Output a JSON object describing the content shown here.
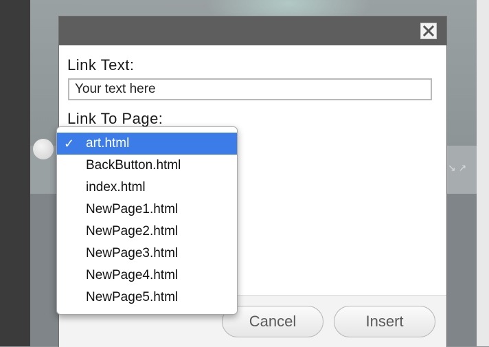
{
  "dialog": {
    "close_glyph": "×",
    "link_text_label": "Link Text:",
    "link_text_value": "Your text here",
    "link_to_page_label": "Link To Page:",
    "cancel_label": "Cancel",
    "insert_label": "Insert"
  },
  "dropdown": {
    "checkmark": "✓",
    "selected_index": 0,
    "options": [
      "art.html",
      "BackButton.html",
      "index.html",
      "NewPage1.html",
      "NewPage2.html",
      "NewPage3.html",
      "NewPage4.html",
      "NewPage5.html"
    ]
  },
  "colors": {
    "titlebar": "#5e5e5e",
    "selected_item": "#3b7ce8"
  }
}
